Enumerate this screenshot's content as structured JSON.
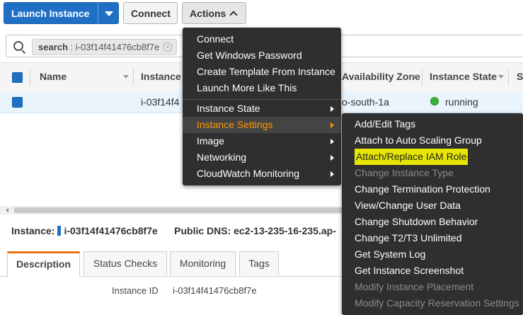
{
  "toolbar": {
    "launch_label": "Launch Instance",
    "connect_label": "Connect",
    "actions_label": "Actions"
  },
  "search": {
    "chip_key": "search",
    "chip_value": "i-03f14f41476cb8f7e"
  },
  "table": {
    "headers": [
      "Name",
      "Instance I",
      "Availability Zone",
      "Instance State",
      "S"
    ],
    "row": {
      "instance_id": "i-03f14f4",
      "az": "o-south-1a",
      "state": "running"
    }
  },
  "summary": {
    "instance_label": "Instance:",
    "instance_value": "i-03f14f41476cb8f7e",
    "dns_label": "Public DNS:",
    "dns_value": "ec2-13-235-16-235.ap-"
  },
  "tabs": [
    "Description",
    "Status Checks",
    "Monitoring",
    "Tags"
  ],
  "details": {
    "instance_id_label": "Instance ID",
    "instance_id_value": "i-03f14f41476cb8f7e"
  },
  "actions_menu": {
    "top": [
      "Connect",
      "Get Windows Password",
      "Create Template From Instance",
      "Launch More Like This"
    ],
    "groups": [
      "Instance State",
      "Instance Settings",
      "Image",
      "Networking",
      "CloudWatch Monitoring"
    ]
  },
  "settings_menu": [
    "Add/Edit Tags",
    "Attach to Auto Scaling Group",
    "Attach/Replace IAM Role",
    "Change Instance Type",
    "Change Termination Protection",
    "View/Change User Data",
    "Change Shutdown Behavior",
    "Change T2/T3 Unlimited",
    "Get System Log",
    "Get Instance Screenshot",
    "Modify Instance Placement",
    "Modify Capacity Reservation Settings"
  ],
  "colors": {
    "accent": "#1f6fc5",
    "menu_bg": "#2f2f2f",
    "highlight": "#ff9900",
    "running": "#3db33d"
  }
}
